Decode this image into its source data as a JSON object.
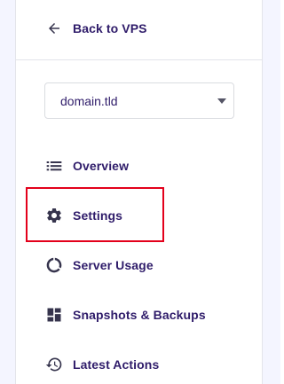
{
  "back": {
    "label": "Back to VPS",
    "icon": "arrow-left-icon"
  },
  "server_select": {
    "value": "domain.tld",
    "icon": "caret-down-icon"
  },
  "nav": {
    "items": [
      {
        "label": "Overview",
        "icon": "list-icon"
      },
      {
        "label": "Settings",
        "icon": "gear-icon",
        "highlighted": true
      },
      {
        "label": "Server Usage",
        "icon": "donut-chart-icon"
      },
      {
        "label": "Snapshots & Backups",
        "icon": "dashboard-grid-icon"
      },
      {
        "label": "Latest Actions",
        "icon": "history-icon"
      }
    ]
  },
  "colors": {
    "text": "#2f1c6a",
    "icon": "#36344d",
    "highlight": "#e3001b",
    "border": "#e3e4ea"
  }
}
